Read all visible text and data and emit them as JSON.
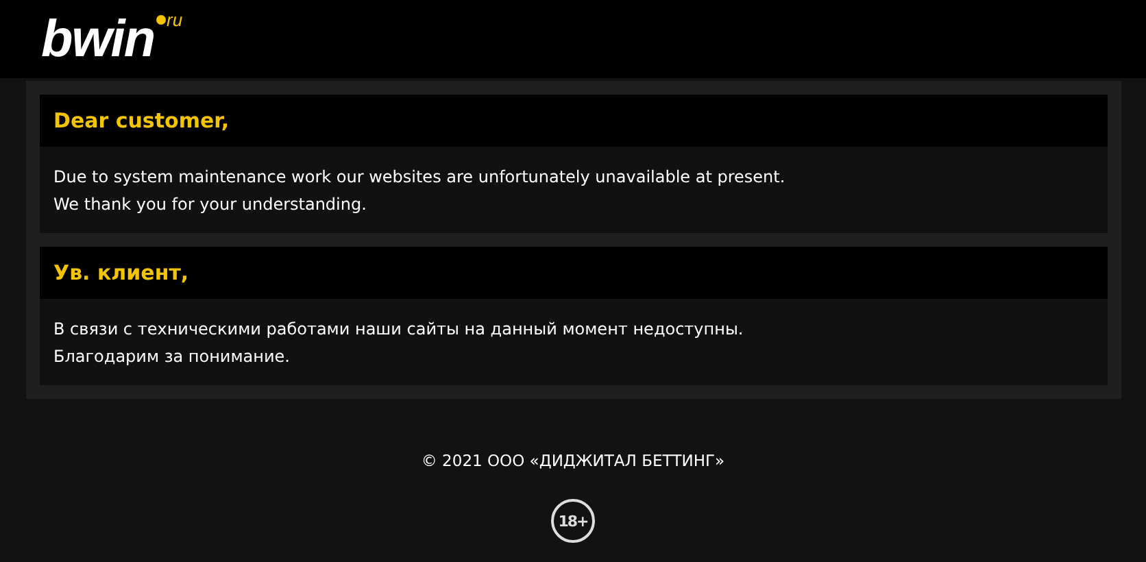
{
  "header": {
    "logo": {
      "text": "bwin",
      "suffix": "ru"
    }
  },
  "notices": [
    {
      "title": "Dear customer,",
      "lines": [
        "Due to system maintenance work our websites are unfortunately unavailable at present.",
        "We thank you for your understanding."
      ]
    },
    {
      "title": "Ув. клиент,",
      "lines": [
        "В связи с техническими работами наши сайты на данный момент недоступны.",
        "Благодарим за понимание."
      ]
    }
  ],
  "footer": {
    "copyright": "© 2021 ООО «ДИДЖИТАЛ БЕТТИНГ»",
    "age_badge": "18+"
  }
}
